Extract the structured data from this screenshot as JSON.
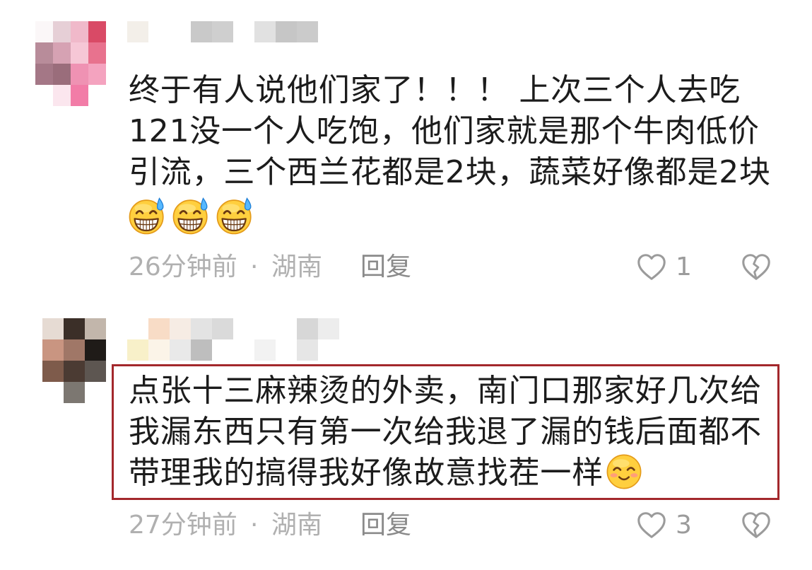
{
  "colors": {
    "background": "#ffffff",
    "text": "#1c1c1c",
    "meta": "#b0b0b0",
    "reply": "#8a8a8a",
    "icon": "#9b9b9b",
    "highlight": "#a3282c"
  },
  "comments": [
    {
      "avatar_mosaic": [
        [
          "#fbf7f8",
          "#e6cfd6",
          "#f0b9ca",
          "#d94a66"
        ],
        [
          "#b88c9a",
          "#d6a2b3",
          "#f6c7d6",
          "#e8728e"
        ],
        [
          "#a47786",
          "#9a6d7b",
          "#ef92b3",
          "#f4a3bf"
        ],
        [
          "#ffffff",
          "#fbe6ee",
          "#f27ca7",
          "#ffffff"
        ]
      ],
      "username_mosaic": [
        [
          "#f3efe9",
          "#ffffff",
          "#ffffff",
          "#c9c9c9",
          "#cfcfcf",
          "#ffffff",
          "#e1e1e1",
          "#c6c6c6",
          "#cbcbcb"
        ]
      ],
      "lines": [
        "终于有人说他们家了！！！ 上次三个人去吃",
        "121没一个人吃饱，他们家就是那个牛肉低价",
        "引流，三个西兰花都是2块，蔬菜好像都是2块"
      ],
      "emojis": [
        "grinning-face-with-sweat-icon",
        "grinning-face-with-sweat-icon",
        "grinning-face-with-sweat-icon"
      ],
      "time": "26分钟前",
      "separator": "·",
      "location": "湖南",
      "reply_label": "回复",
      "like_icon": "heart-outline-icon",
      "like_count": "1",
      "dislike_icon": "broken-heart-icon"
    },
    {
      "avatar_mosaic": [
        [
          "#e6dbd3",
          "#3b2f28",
          "#c2b6ab"
        ],
        [
          "#c99581",
          "#a07767",
          "#1f1b18"
        ],
        [
          "#7e5b4b",
          "#4b3b33",
          "#5d5651"
        ],
        [
          "#ffffff",
          "#7c7771",
          "#ffffff"
        ]
      ],
      "username_mosaic": [
        [
          "#ffffff",
          "#f8dcc6",
          "#f6ece4",
          "#e3e3e3",
          "#dadada",
          "#ffffff",
          "#ffffff",
          "#ffffff",
          "#d7d7d7",
          "#ededed"
        ],
        [
          "#f8f0c9",
          "#fbf4e8",
          "#e9e9e9",
          "#bebebe",
          "#ffffff",
          "#ffffff",
          "#f2f2f2",
          "#ffffff",
          "#e6e6e6",
          "#ffffff"
        ]
      ],
      "lines": [
        "点张十三麻辣烫的外卖，南门口那家好几次给",
        "我漏东西只有第一次给我退了漏的钱后面都不",
        "带理我的搞得我好像故意找茬一样"
      ],
      "trailing_emoji": "smiling-face-with-blush-icon",
      "time": "27分钟前",
      "separator": "·",
      "location": "湖南",
      "reply_label": "回复",
      "like_icon": "heart-outline-icon",
      "like_count": "3",
      "dislike_icon": "broken-heart-icon"
    }
  ]
}
